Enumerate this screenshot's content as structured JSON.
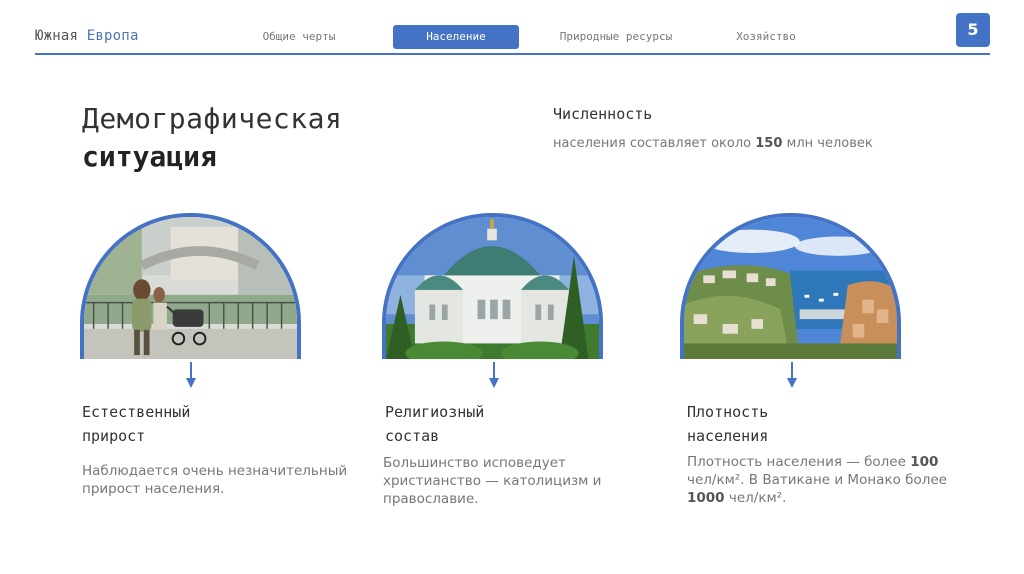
{
  "header": {
    "brand_part1": "Южная",
    "brand_part2": "Европа",
    "nav": [
      "Общие черты",
      "Население",
      "Природные ресурсы",
      "Хозяйство"
    ],
    "active_index": 1,
    "page_number": "5",
    "accent_color": "#4472c4"
  },
  "title": {
    "line1": "Демографическая",
    "line2": "ситуация"
  },
  "population": {
    "heading": "Численность",
    "text_before": "населения составляет около ",
    "number": "150",
    "text_after": " млн человек"
  },
  "columns": [
    {
      "image": "family-street-photo",
      "heading_line1": "Естественный",
      "heading_line2": "прирост",
      "text": "Наблюдается очень незначительный прирост населения."
    },
    {
      "image": "orthodox-cathedral-photo",
      "heading_line1": "Религиозный",
      "heading_line2": "состав",
      "text": "Большинство исповедует христианство — католицизм и православие."
    },
    {
      "image": "monaco-coast-photo",
      "heading_line1": "Плотность",
      "heading_line2": "населения",
      "text_p1": "Плотность населения — более ",
      "num1": "100",
      "text_p2": " чел/км². В Ватикане и Монако более ",
      "num2": "1000",
      "text_p3": " чел/км²."
    }
  ]
}
